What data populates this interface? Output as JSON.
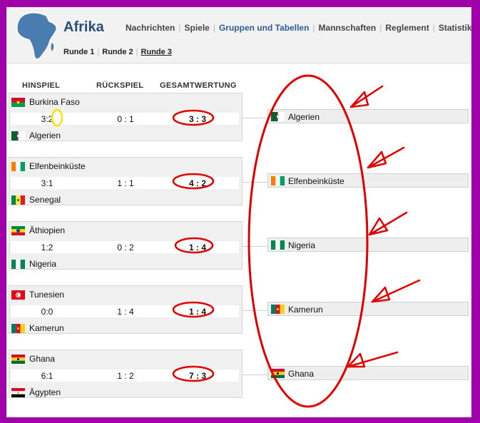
{
  "header": {
    "title": "Afrika",
    "nav": [
      {
        "label": "Nachrichten",
        "active": false
      },
      {
        "label": "Spiele",
        "active": false
      },
      {
        "label": "Gruppen und Tabellen",
        "active": true
      },
      {
        "label": "Mannschaften",
        "active": false
      },
      {
        "label": "Reglement",
        "active": false
      },
      {
        "label": "Statistik",
        "active": false
      }
    ],
    "rounds": [
      {
        "label": "Runde 1",
        "current": false
      },
      {
        "label": "Runde 2",
        "current": false
      },
      {
        "label": "Runde 3",
        "current": true
      }
    ]
  },
  "columns": {
    "first_leg": "HINSPIEL",
    "second_leg": "RÜCKSPIEL",
    "aggregate": "GESAMTWERTUNG"
  },
  "matches": [
    {
      "home": "Burkina Faso",
      "away": "Algerien",
      "first_leg": "3:2",
      "second_leg": "0 : 1",
      "aggregate": "3 : 3",
      "winner": "Algerien"
    },
    {
      "home": "Elfenbeinküste",
      "away": "Senegal",
      "first_leg": "3:1",
      "second_leg": "1 : 1",
      "aggregate": "4 : 2",
      "winner": "Elfenbeinküste"
    },
    {
      "home": "Äthiopien",
      "away": "Nigeria",
      "first_leg": "1:2",
      "second_leg": "0 : 2",
      "aggregate": "1 : 4",
      "winner": "Nigeria"
    },
    {
      "home": "Tunesien",
      "away": "Kamerun",
      "first_leg": "0:0",
      "second_leg": "1 : 4",
      "aggregate": "1 : 4",
      "winner": "Kamerun"
    },
    {
      "home": "Ghana",
      "away": "Ägypten",
      "first_leg": "6:1",
      "second_leg": "1 : 2",
      "aggregate": "7 : 3",
      "winner": "Ghana"
    }
  ],
  "colors": {
    "frame_border": "#a000a8",
    "annotation": "#e00000",
    "highlight": "#f5e400",
    "title": "#2a4f7a",
    "active_nav": "#2c5c96"
  }
}
